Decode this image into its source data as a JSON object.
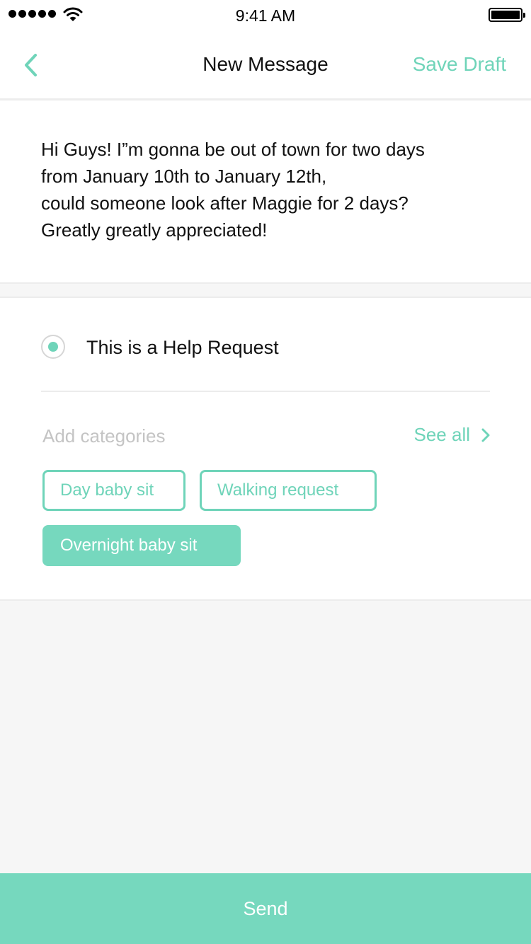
{
  "status_bar": {
    "time": "9:41 AM",
    "signal_icon": "cellular-signal-icon",
    "wifi_icon": "wifi-icon",
    "battery_icon": "battery-icon",
    "battery_level": 1.0
  },
  "nav": {
    "back_icon": "chevron-left-icon",
    "title": "New Message",
    "save_draft": "Save Draft"
  },
  "message": {
    "lines": [
      "Hi Guys! I”m gonna be out of town for two days",
      "from January 10th to January 12th,",
      "could someone look after Maggie for 2 days?",
      "Greatly greatly appreciated!"
    ]
  },
  "help_request": {
    "label": "This is a Help Request",
    "selected": true
  },
  "categories": {
    "placeholder": "Add categories",
    "see_all": "See all",
    "see_all_icon": "chevron-right-icon",
    "chips": [
      {
        "label": "Day baby sit",
        "selected": false
      },
      {
        "label": "Walking request",
        "selected": false
      },
      {
        "label": "Overnight baby sit",
        "selected": true
      }
    ]
  },
  "send": {
    "label": "Send"
  },
  "colors": {
    "accent": "#6fd4b9",
    "accent_fill": "#76d8be",
    "background": "#f6f6f6",
    "placeholder": "#c4c4c4"
  }
}
